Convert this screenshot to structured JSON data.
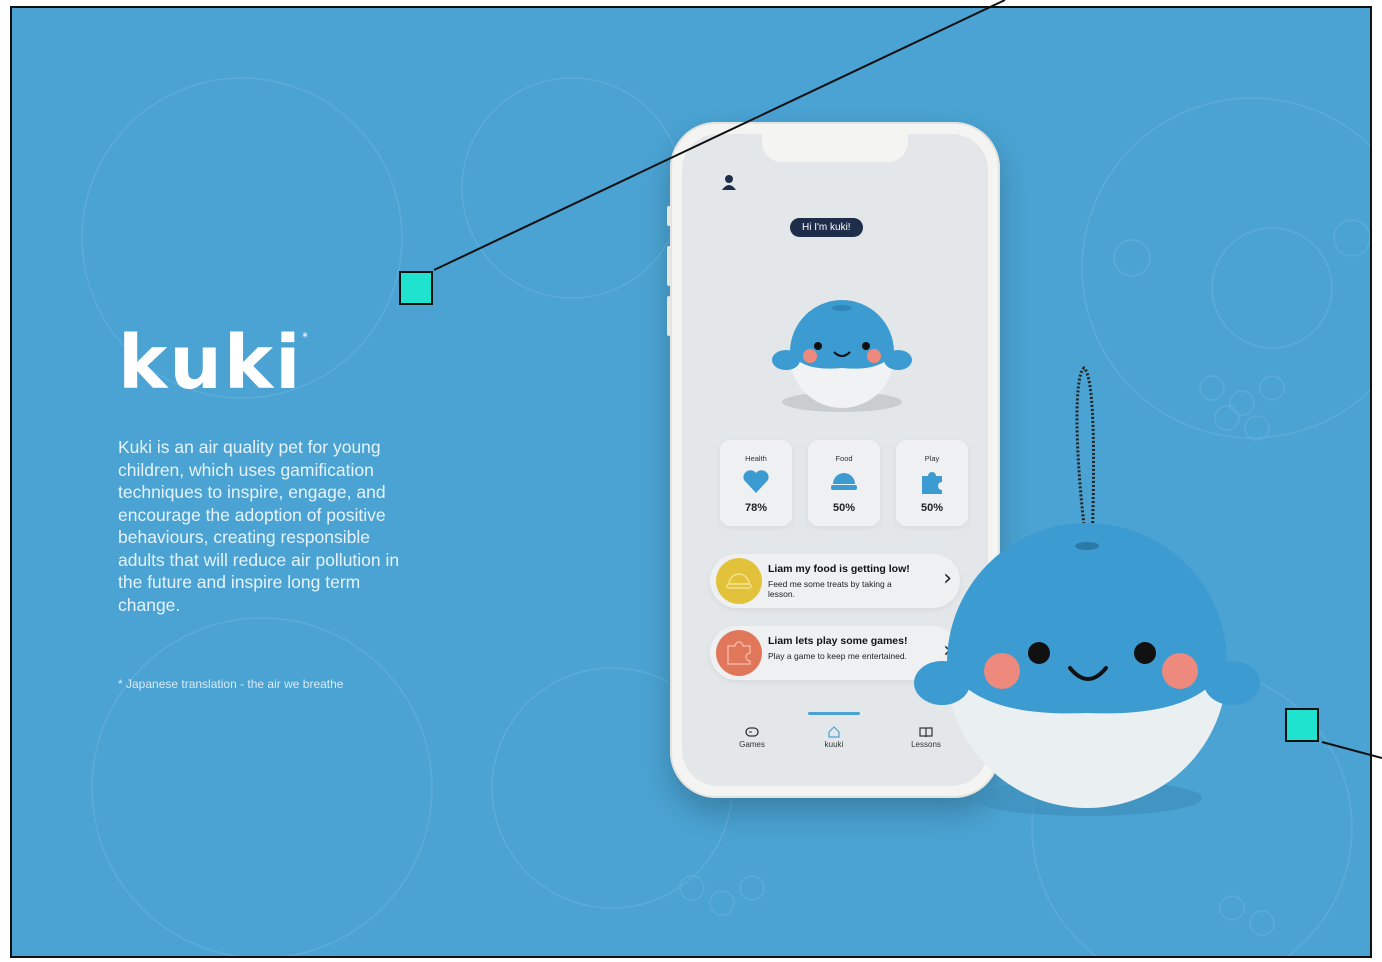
{
  "brand": {
    "name": "kuki",
    "asterisk": "*"
  },
  "description": "Kuki is an air quality pet for young children, which uses gamification techniques to inspire, engage, and encourage the adoption of positive behaviours, creating responsible adults that will reduce air pollution in the future and inspire long term change.",
  "footnote": "* Japanese translation - the air we breathe",
  "colors": {
    "background": "#4aa3d3",
    "pet_blue": "#3c9bd0",
    "marker": "#1fe3cf",
    "greeting_bg": "#1e2d4a"
  },
  "app": {
    "greeting": "Hi I'm kuki!",
    "stats": [
      {
        "label": "Health",
        "value": "78%",
        "icon": "heart-icon"
      },
      {
        "label": "Food",
        "value": "50%",
        "icon": "food-bowl-icon"
      },
      {
        "label": "Play",
        "value": "50%",
        "icon": "puzzle-icon"
      }
    ],
    "notices": [
      {
        "title": "Liam my food is getting low!",
        "subtitle": "Feed me some treats by taking a lesson.",
        "color": "#e2c23a",
        "icon": "food-bowl-icon"
      },
      {
        "title": "Liam lets play some games!",
        "subtitle": "Play a game to keep me entertained.",
        "color": "#e0775a",
        "icon": "puzzle-icon"
      }
    ],
    "tabs": [
      {
        "label": "Games",
        "icon": "gamepad-icon"
      },
      {
        "label": "kuuki",
        "icon": "home-icon"
      },
      {
        "label": "Lessons",
        "icon": "book-icon"
      }
    ]
  }
}
